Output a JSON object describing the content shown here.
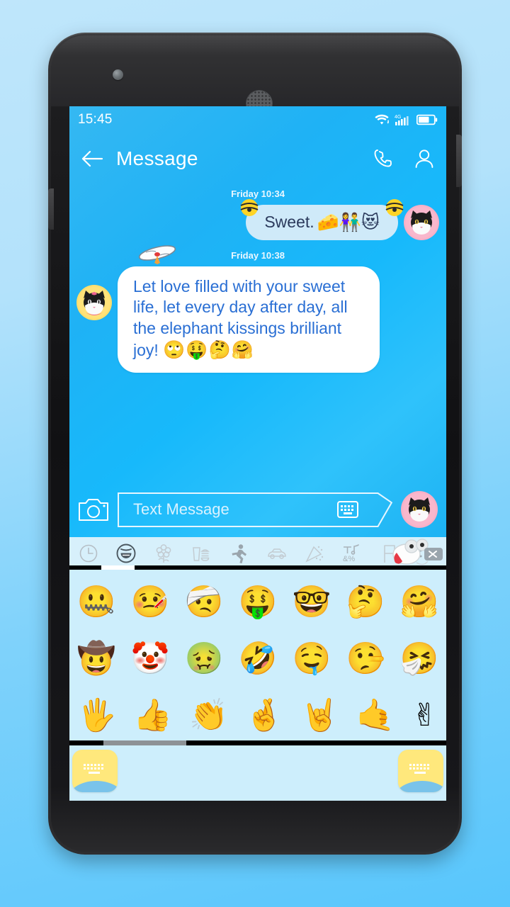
{
  "statusbar": {
    "time": "15:45",
    "icons": [
      "wifi-icon",
      "signal-4g-icon",
      "battery-icon"
    ],
    "network_label": "4G",
    "battery_level": "65"
  },
  "appbar": {
    "back_icon": "back-arrow-icon",
    "title": "Message",
    "call_icon": "phone-icon",
    "contact_icon": "person-icon"
  },
  "conversation": [
    {
      "timestamp": "Friday 10:34",
      "side": "outgoing",
      "text": "Sweet.",
      "emojis": "🧀👫😻",
      "decoration": "bell-decoration",
      "avatar": "cat-avatar-pink"
    },
    {
      "timestamp": "Friday 10:38",
      "side": "incoming",
      "text": "Let love filled with your sweet life, let every day after day, all the elephant kissings brilliant joy!",
      "emojis": "🙄🤑🤔🤗",
      "decoration": "propeller-hat-decoration",
      "avatar": "cat-avatar-yellow"
    }
  ],
  "composer": {
    "camera_icon": "camera-icon",
    "placeholder": "Text Message",
    "keyboard_icon": "keyboard-icon",
    "avatar": "cat-avatar-pink"
  },
  "keyboard": {
    "tabs": [
      {
        "name": "recent-tab",
        "icon": "clock-icon",
        "selected": false
      },
      {
        "name": "smileys-tab",
        "icon": "smiley-icon",
        "selected": true
      },
      {
        "name": "nature-tab",
        "icon": "flower-icon",
        "selected": false
      },
      {
        "name": "food-tab",
        "icon": "food-icon",
        "selected": false
      },
      {
        "name": "activity-tab",
        "icon": "runner-icon",
        "selected": false
      },
      {
        "name": "travel-tab",
        "icon": "car-icon",
        "selected": false
      },
      {
        "name": "objects-tab",
        "icon": "party-popper-icon",
        "selected": false
      },
      {
        "name": "symbols-tab",
        "icon": "symbols-icon",
        "selected": false
      },
      {
        "name": "flags-tab",
        "icon": "flag-icon",
        "selected": false
      },
      {
        "name": "emoticons-tab",
        "icon": "emoticon-icon",
        "selected": false
      }
    ],
    "delete_key_icon": "delete-key-icon",
    "mascot": "mouse-mascot-sticker",
    "rows": [
      [
        "🤐",
        "🤒",
        "🤕",
        "🤑",
        "🤓",
        "🤔",
        "🤗"
      ],
      [
        "🤠",
        "🤡",
        "🤢",
        "🤣",
        "🤤",
        "🤥",
        "🤧"
      ],
      [
        "🖐",
        "👍",
        "👏",
        "🤞",
        "🤘",
        "🤙",
        "✌"
      ]
    ],
    "page_indicator": "page-1-of-3",
    "left_key_icon": "keyboard-switch-icon",
    "right_key_icon": "keyboard-switch-icon"
  },
  "colors": {
    "accent": "#23b6f6",
    "bubble_out": "#cfeaf9",
    "bubble_in": "#ffffff",
    "text_in": "#2a6fd4",
    "keyboard_bg": "#cdeefc",
    "key_yellow": "#ffe87c",
    "wallpaper": "#7fd2fb"
  }
}
